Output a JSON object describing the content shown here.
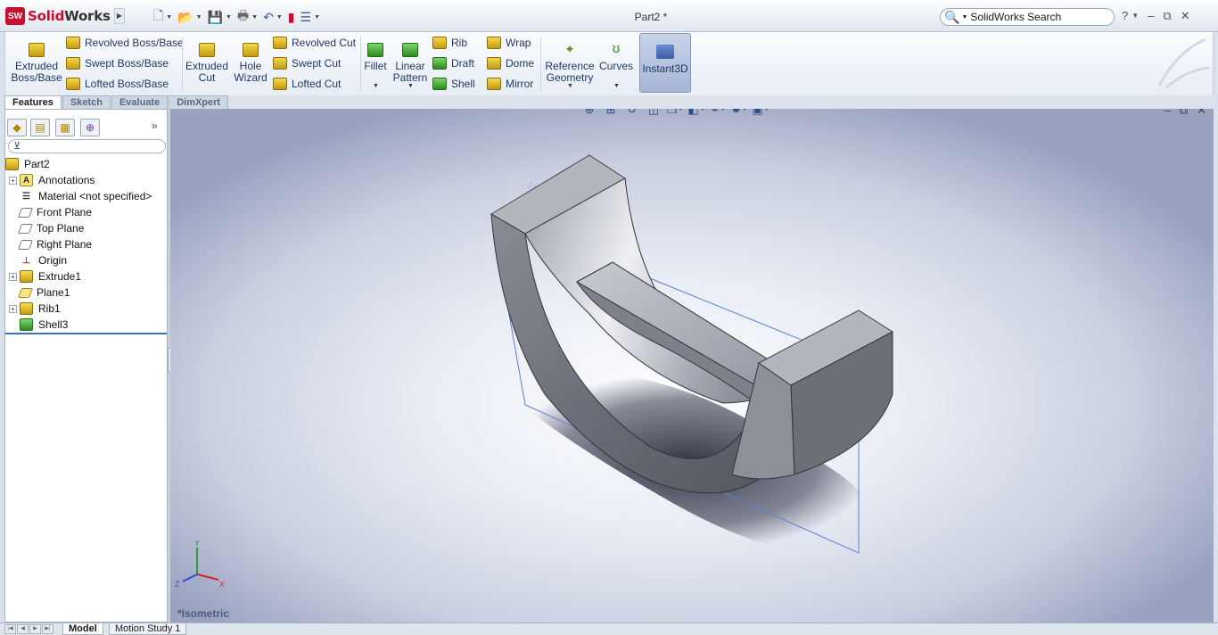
{
  "app": {
    "brand_prefix": "Solid",
    "brand_suffix": "Works",
    "logo_badge": "SW"
  },
  "window": {
    "title": "Part2 *"
  },
  "search": {
    "placeholder": "SolidWorks Search"
  },
  "window_controls": {
    "help": "?",
    "minimize": "–",
    "restore": "⧉",
    "close": "✕"
  },
  "ribbon": {
    "extruded_boss": "Extruded Boss/Base",
    "revolved_boss": "Revolved Boss/Base",
    "swept_boss": "Swept Boss/Base",
    "lofted_boss": "Lofted Boss/Base",
    "extruded_cut": "Extruded Cut",
    "hole_wizard": "Hole Wizard",
    "revolved_cut": "Revolved Cut",
    "swept_cut": "Swept Cut",
    "lofted_cut": "Lofted Cut",
    "fillet": "Fillet",
    "linear_pattern": "Linear Pattern",
    "rib": "Rib",
    "draft": "Draft",
    "shell": "Shell",
    "wrap": "Wrap",
    "dome": "Dome",
    "mirror": "Mirror",
    "reference_geometry": "Reference Geometry",
    "curves": "Curves",
    "instant3d": "Instant3D"
  },
  "tabs": {
    "features": "Features",
    "sketch": "Sketch",
    "evaluate": "Evaluate",
    "dimxpert": "DimXpert"
  },
  "tree": {
    "root": "Part2",
    "items": [
      "Annotations",
      "Material <not specified>",
      "Front Plane",
      "Top Plane",
      "Right Plane",
      "Origin",
      "Extrude1",
      "Plane1",
      "Rib1",
      "Shell3"
    ]
  },
  "viewport": {
    "view_name": "*Isometric",
    "triad_x": "X",
    "triad_y": "Y",
    "triad_z": "Z"
  },
  "status": {
    "tab_model": "Model",
    "tab_motion": "Motion Study 1"
  }
}
